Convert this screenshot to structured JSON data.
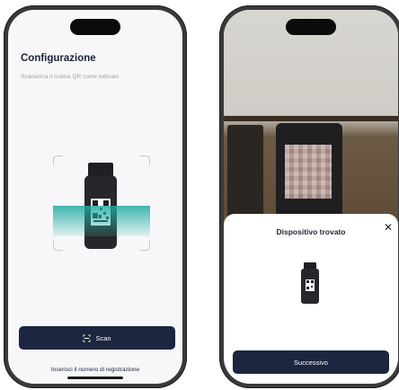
{
  "left_screen": {
    "title": "Configurazione",
    "subtitle": "Scansiona il codice QR come indicato",
    "scan_button_label": "Scan",
    "scan_button_icon": "scan-frame-icon",
    "registration_link": "Inserisci il numero di registrazione"
  },
  "right_screen": {
    "sheet_title": "Dispositivo trovato",
    "close_icon": "close-icon",
    "close_glyph": "✕",
    "next_button_label": "Successivo"
  },
  "colors": {
    "primary_button": "#1c2640",
    "scan_beam": "#1eaaa0",
    "title_text": "#1b2438"
  }
}
